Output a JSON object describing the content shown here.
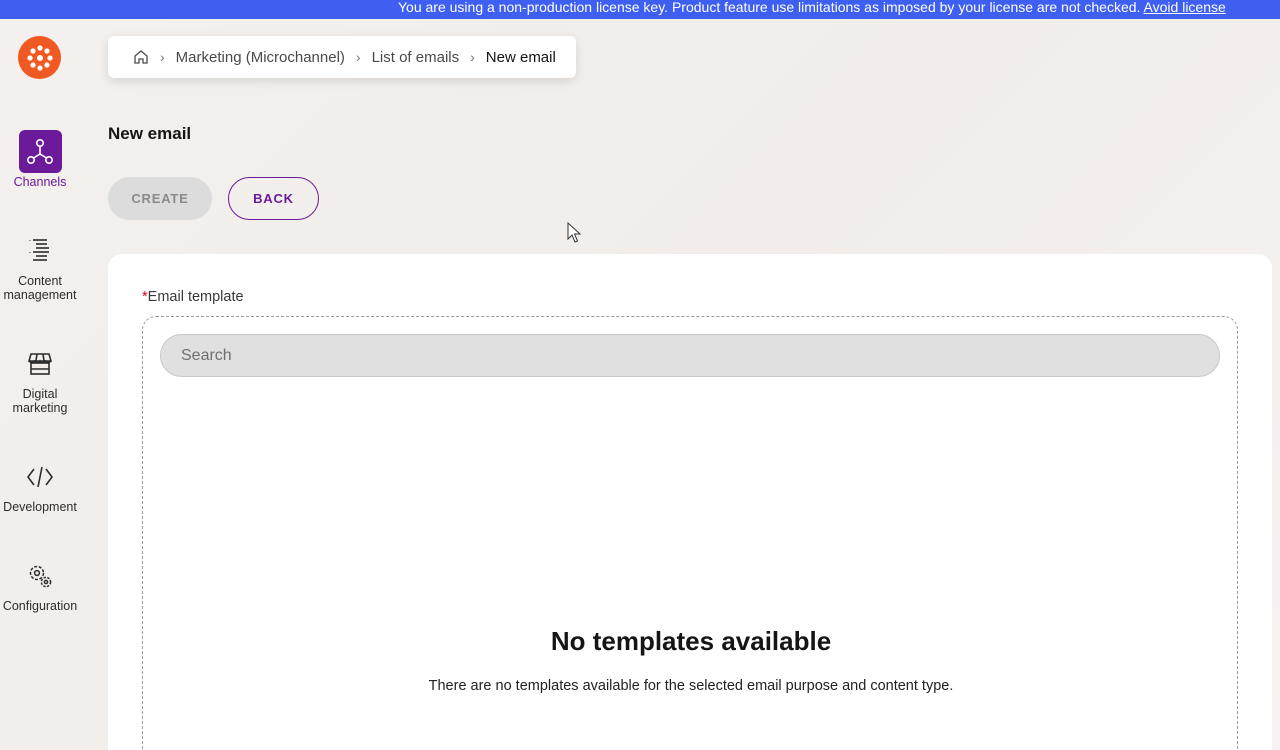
{
  "license": {
    "message": "You are using a non-production license key. Product feature use limitations as imposed by your license are not checked. ",
    "link": "Avoid license"
  },
  "sidebar": {
    "items": [
      {
        "label": "Channels",
        "icon": "channels-icon",
        "active": true
      },
      {
        "label": "Content management",
        "icon": "content-management-icon",
        "active": false
      },
      {
        "label": "Digital marketing",
        "icon": "store-icon",
        "active": false
      },
      {
        "label": "Development",
        "icon": "code-icon",
        "active": false
      },
      {
        "label": "Configuration",
        "icon": "gears-icon",
        "active": false
      }
    ]
  },
  "breadcrumb": {
    "items": [
      "Marketing (Microchannel)",
      "List of emails"
    ],
    "current": "New email"
  },
  "page": {
    "title": "New email",
    "create_label": "CREATE",
    "back_label": "BACK"
  },
  "form": {
    "required_mark": "*",
    "template_label": "Email template",
    "search_placeholder": "Search",
    "search_value": "",
    "empty_title": "No templates available",
    "empty_description": "There are no templates available for the selected email purpose and content type."
  },
  "colors": {
    "banner": "#3e5ff1",
    "accent": "#6b1b9a",
    "logo": "#f05a22"
  }
}
